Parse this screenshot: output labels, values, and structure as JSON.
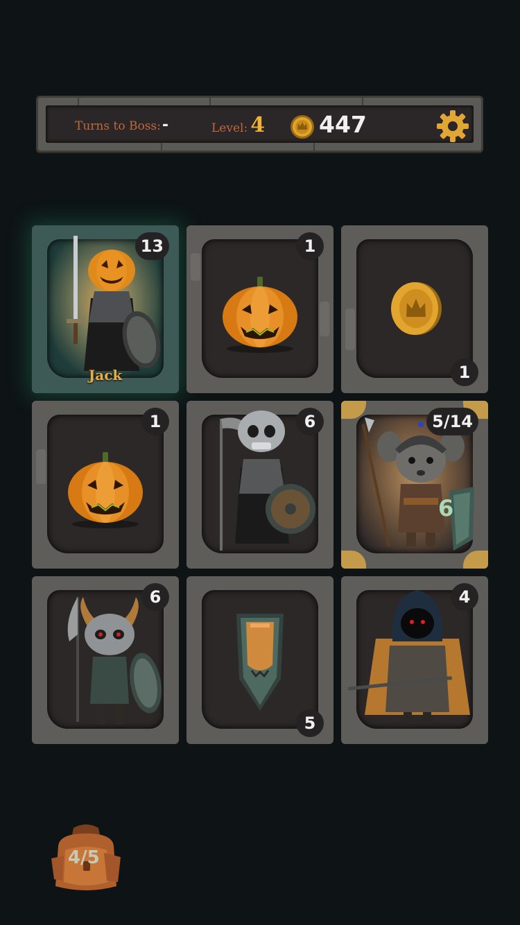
{
  "hud": {
    "turns_label": "Turns to Boss:",
    "turns_value": "-",
    "level_label": "Level:",
    "level_value": "4",
    "gold_value": "447"
  },
  "cards": [
    {
      "id": "jack",
      "type": "hero",
      "name": "Jack",
      "value": "13",
      "icon": "pumpkin-knight-icon"
    },
    {
      "id": "pumpkin-1",
      "type": "item",
      "value": "1",
      "icon": "pumpkin-icon"
    },
    {
      "id": "coin",
      "type": "coin",
      "value": "1",
      "icon": "gold-coin-icon"
    },
    {
      "id": "pumpkin-2",
      "type": "item",
      "value": "1",
      "icon": "pumpkin-icon"
    },
    {
      "id": "skeleton-reaper",
      "type": "enemy",
      "value": "6",
      "icon": "skeleton-scythe-icon"
    },
    {
      "id": "mouse-guard",
      "type": "enemy",
      "value": "5/14",
      "shield": "6",
      "icon": "mouse-spearman-icon"
    },
    {
      "id": "horned-skeleton",
      "type": "enemy",
      "value": "6",
      "icon": "horned-skeleton-icon"
    },
    {
      "id": "shield",
      "type": "item",
      "value": "5",
      "icon": "shield-icon"
    },
    {
      "id": "hooded-rogue",
      "type": "enemy",
      "value": "4",
      "icon": "hooded-rogue-icon"
    }
  ],
  "backpack": {
    "label": "4/5",
    "icon": "backpack-icon"
  },
  "colors": {
    "background": "#0e1416",
    "accent_gold": "#f0b33a",
    "label_orange": "#c2683d",
    "stone": "#5e5d5a"
  }
}
